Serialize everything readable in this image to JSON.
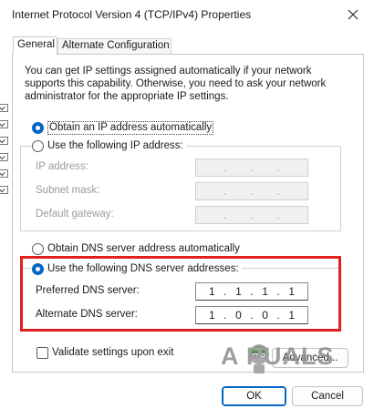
{
  "window": {
    "title": "Internet Protocol Version 4 (TCP/IPv4) Properties",
    "close_glyph": "✕"
  },
  "tabs": [
    {
      "label": "General",
      "selected": true
    },
    {
      "label": "Alternate Configuration",
      "selected": false
    }
  ],
  "description": "You can get IP settings assigned automatically if your network supports this capability. Otherwise, you need to ask your network administrator for the appropriate IP settings.",
  "ip_settings": {
    "auto_label": "Obtain an IP address automatically",
    "manual_label": "Use the following IP address:",
    "selected": "auto",
    "fields": [
      {
        "label": "IP address:",
        "octets": [
          "",
          "",
          "",
          ""
        ],
        "enabled": false
      },
      {
        "label": "Subnet mask:",
        "octets": [
          "",
          "",
          "",
          ""
        ],
        "enabled": false
      },
      {
        "label": "Default gateway:",
        "octets": [
          "",
          "",
          "",
          ""
        ],
        "enabled": false
      }
    ]
  },
  "dns_settings": {
    "auto_label": "Obtain DNS server address automatically",
    "manual_label": "Use the following DNS server addresses:",
    "selected": "manual",
    "preferred": {
      "label": "Preferred DNS server:",
      "octets": [
        "1",
        "1",
        "1",
        "1"
      ]
    },
    "alternate": {
      "label": "Alternate DNS server:",
      "octets": [
        "1",
        "0",
        "0",
        "1"
      ]
    }
  },
  "validate": {
    "label": "Validate settings upon exit",
    "checked": false
  },
  "buttons": {
    "advanced": "Advanced...",
    "ok": "OK",
    "cancel": "Cancel"
  },
  "watermark": {
    "text": "A PUALS"
  },
  "colors": {
    "accent": "#0067c0",
    "highlight": "#e0201e"
  }
}
